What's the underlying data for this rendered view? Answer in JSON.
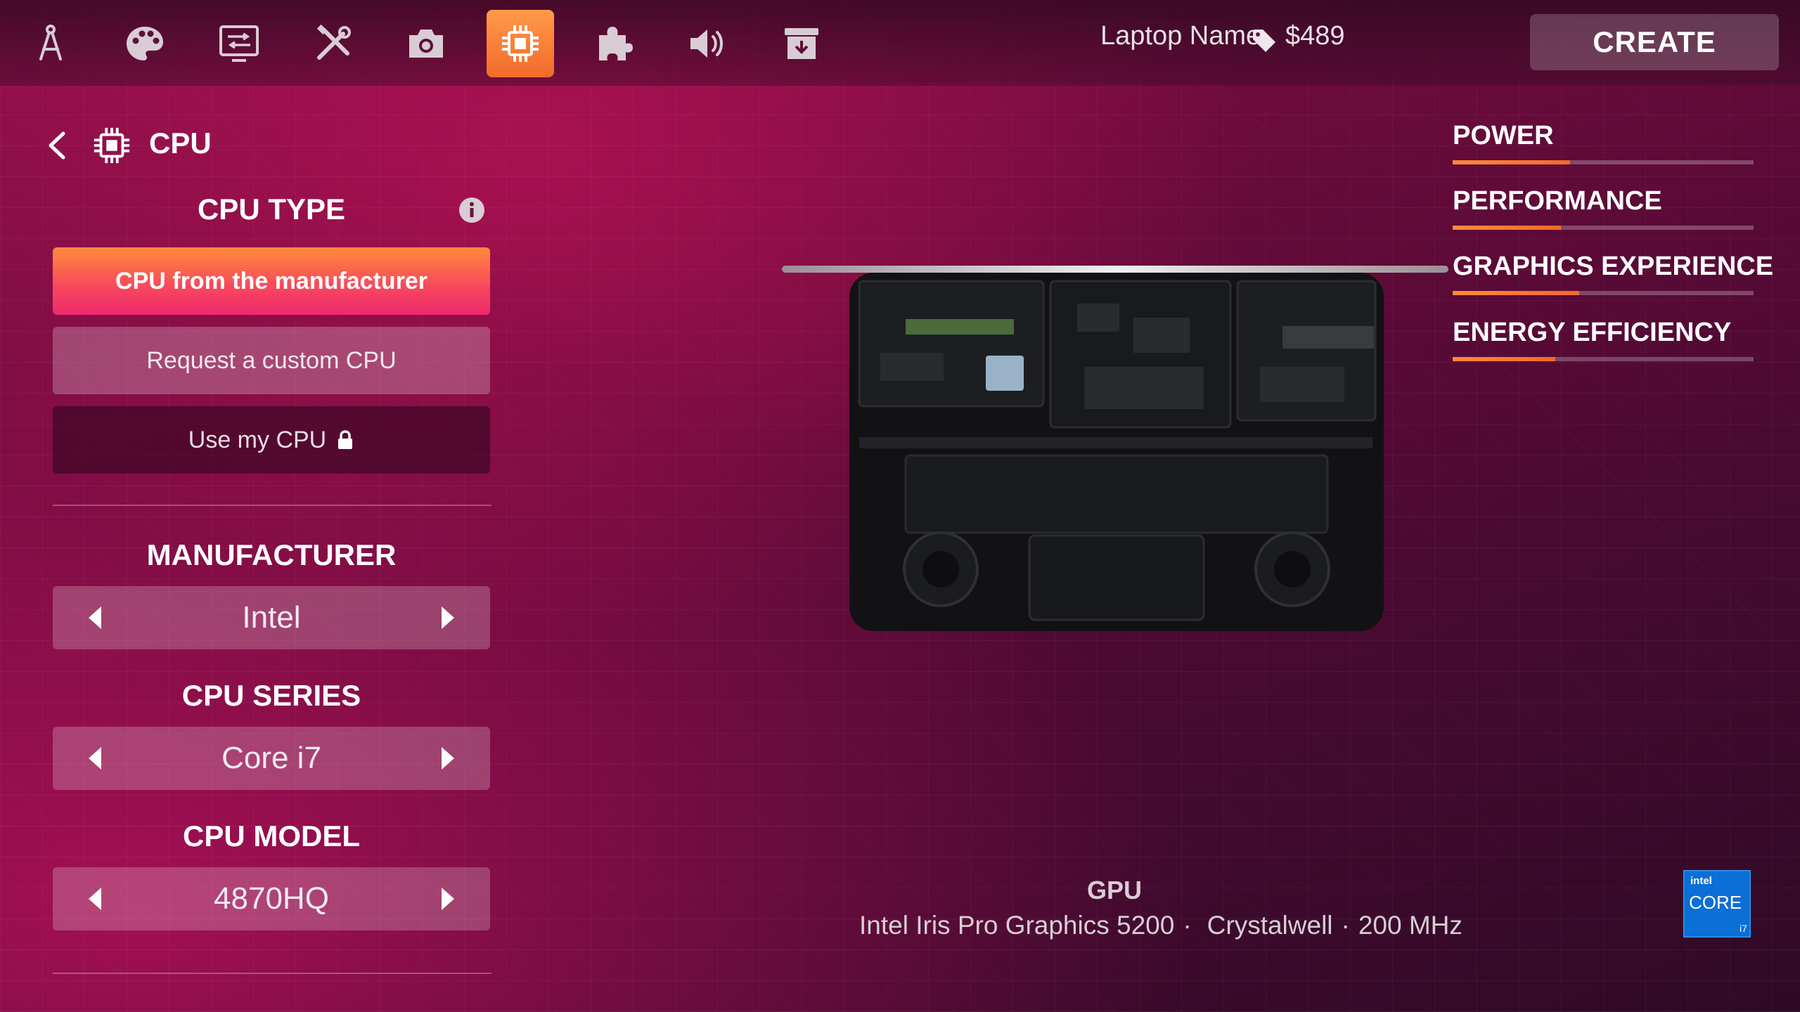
{
  "toolbar": {
    "tools": [
      {
        "icon": "compass-icon"
      },
      {
        "icon": "palette-icon"
      },
      {
        "icon": "display-settings-icon"
      },
      {
        "icon": "tools-icon"
      },
      {
        "icon": "camera-icon"
      },
      {
        "icon": "cpu-icon",
        "active": true
      },
      {
        "icon": "puzzle-icon"
      },
      {
        "icon": "speaker-icon"
      },
      {
        "icon": "package-icon"
      }
    ],
    "laptop_name": "Laptop Name",
    "price": "$489",
    "create_label": "CREATE"
  },
  "panel": {
    "title": "CPU",
    "cpu_type": {
      "heading": "CPU TYPE",
      "options": [
        {
          "label": "CPU from the manufacturer",
          "state": "selected"
        },
        {
          "label": "Request a custom CPU",
          "state": "normal"
        },
        {
          "label": "Use my CPU",
          "state": "locked"
        }
      ]
    },
    "manufacturer": {
      "heading": "MANUFACTURER",
      "value": "Intel"
    },
    "series": {
      "heading": "CPU SERIES",
      "value": "Core i7"
    },
    "model": {
      "heading": "CPU MODEL",
      "value": "4870HQ"
    }
  },
  "stats": [
    {
      "label": "POWER",
      "value": 0.39
    },
    {
      "label": "PERFORMANCE",
      "value": 0.36
    },
    {
      "label": "GRAPHICS EXPERIENCE",
      "value": 0.42
    },
    {
      "label": "ENERGY EFFICIENCY",
      "value": 0.34
    }
  ],
  "gpu": {
    "heading": "GPU",
    "name": "Intel Iris Pro Graphics 5200",
    "cache": "Crystalwell",
    "frequency": "200 MHz",
    "separator": "·"
  },
  "badge": {
    "brand": "intel",
    "line": "CORE",
    "tier": "i7"
  },
  "colors": {
    "accent": "#f26a2a",
    "selected_gradient_start": "#ff8a3a",
    "selected_gradient_end": "#ee2a6c",
    "intel_blue": "#0a6fd6"
  }
}
